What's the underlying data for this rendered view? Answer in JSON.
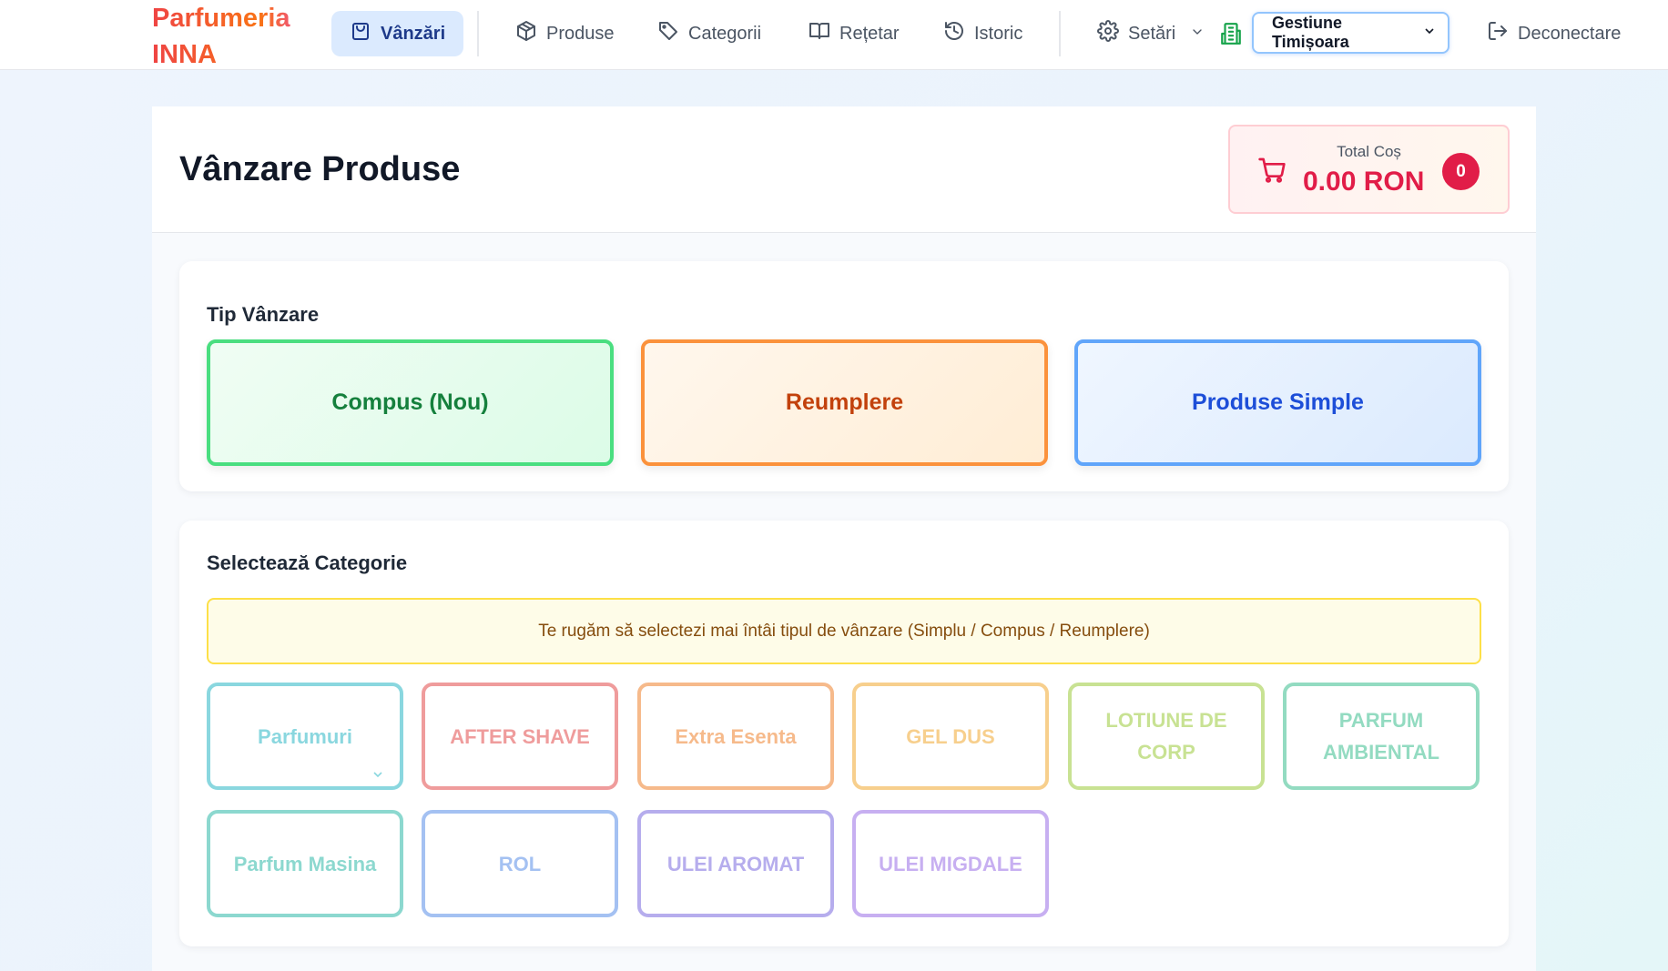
{
  "brand": {
    "line1": "Parfumeria",
    "line2": "INNA"
  },
  "nav": {
    "items": [
      {
        "label": "Vânzări",
        "icon": "shopping-bag-icon",
        "active": true
      },
      {
        "label": "Produse",
        "icon": "box-icon"
      },
      {
        "label": "Categorii",
        "icon": "tag-icon"
      },
      {
        "label": "Rețetar",
        "icon": "book-open-icon"
      },
      {
        "label": "Istoric",
        "icon": "history-icon"
      }
    ],
    "settings_label": "Setări",
    "gestiune_selected": "Gestiune Timișoara",
    "logout_label": "Deconectare"
  },
  "page": {
    "title": "Vânzare Produse",
    "cart": {
      "label": "Total Coș",
      "value": "0.00 RON",
      "count": "0"
    }
  },
  "sale_type": {
    "title": "Tip Vânzare",
    "options": [
      "Compus (Nou)",
      "Reumplere",
      "Produse Simple"
    ]
  },
  "category": {
    "title": "Selectează Categorie",
    "warning": "Te rugăm să selectezi mai întâi tipul de vânzare (Simplu / Compus / Reumplere)",
    "items": [
      {
        "label": "Parfumuri",
        "color": "#2bb8c6"
      },
      {
        "label": "AFTER SHAVE",
        "color": "#e24c4c"
      },
      {
        "label": "Extra Esenta",
        "color": "#f0822e"
      },
      {
        "label": "GEL DUS",
        "color": "#f2a831"
      },
      {
        "label": "LOTIUNE DE CORP",
        "color": "#9ccc3c"
      },
      {
        "label": "PARFUM AMBIENTAL",
        "color": "#3cbf8f"
      },
      {
        "label": "Parfum Masina",
        "color": "#2fb9a9"
      },
      {
        "label": "ROL",
        "color": "#5b8fe8"
      },
      {
        "label": "ULEI AROMAT",
        "color": "#7c6be0"
      },
      {
        "label": "ULEI MIGDALE",
        "color": "#9a6ee6"
      }
    ]
  }
}
